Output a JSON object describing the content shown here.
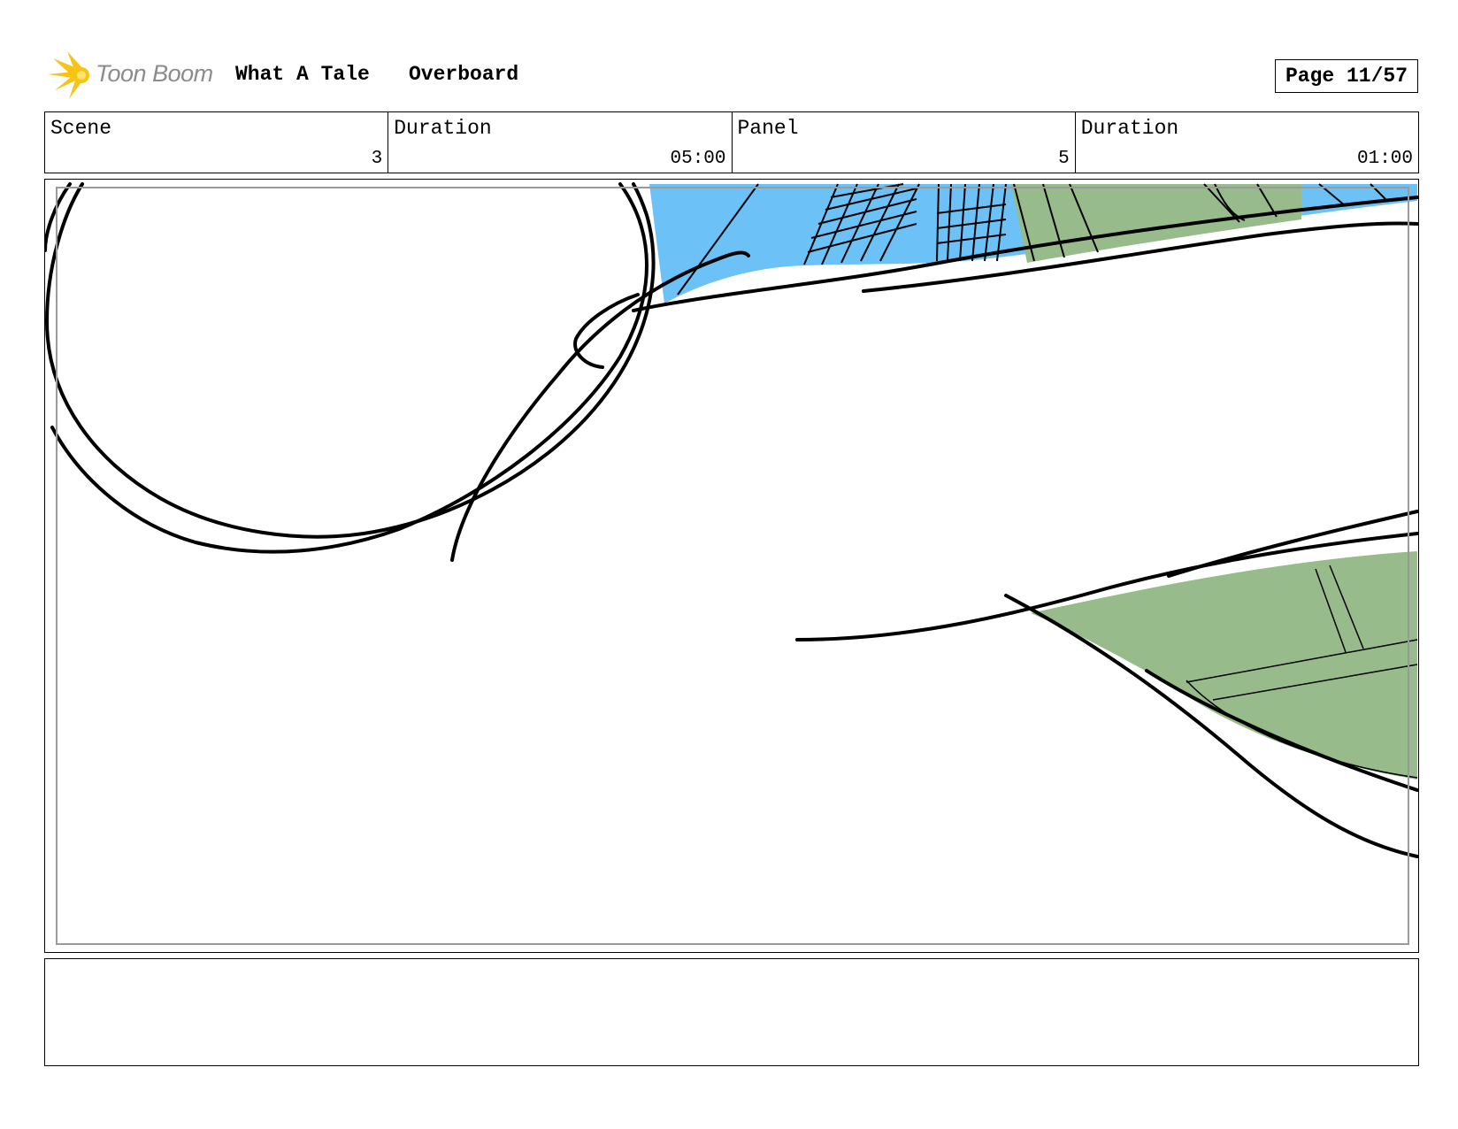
{
  "header": {
    "logo_text": "Toon Boom",
    "project_title": "What A Tale",
    "episode_title": "Overboard",
    "page_label": "Page 11/57"
  },
  "info": {
    "scene_label": "Scene",
    "scene_value": "3",
    "scene_duration_label": "Duration",
    "scene_duration_value": "05:00",
    "panel_label": "Panel",
    "panel_value": "5",
    "panel_duration_label": "Duration",
    "panel_duration_value": "01:00"
  },
  "notes": {
    "text": ""
  },
  "colors": {
    "sky_blue": "#6cc1f7",
    "deck_green": "#97bb8b",
    "logo_yellow": "#f6c415",
    "logo_text_gray": "#8c8c8c",
    "safe_area_gray": "#9a9a9a"
  },
  "icons": {
    "logo": "toon-boom-star-logo"
  }
}
